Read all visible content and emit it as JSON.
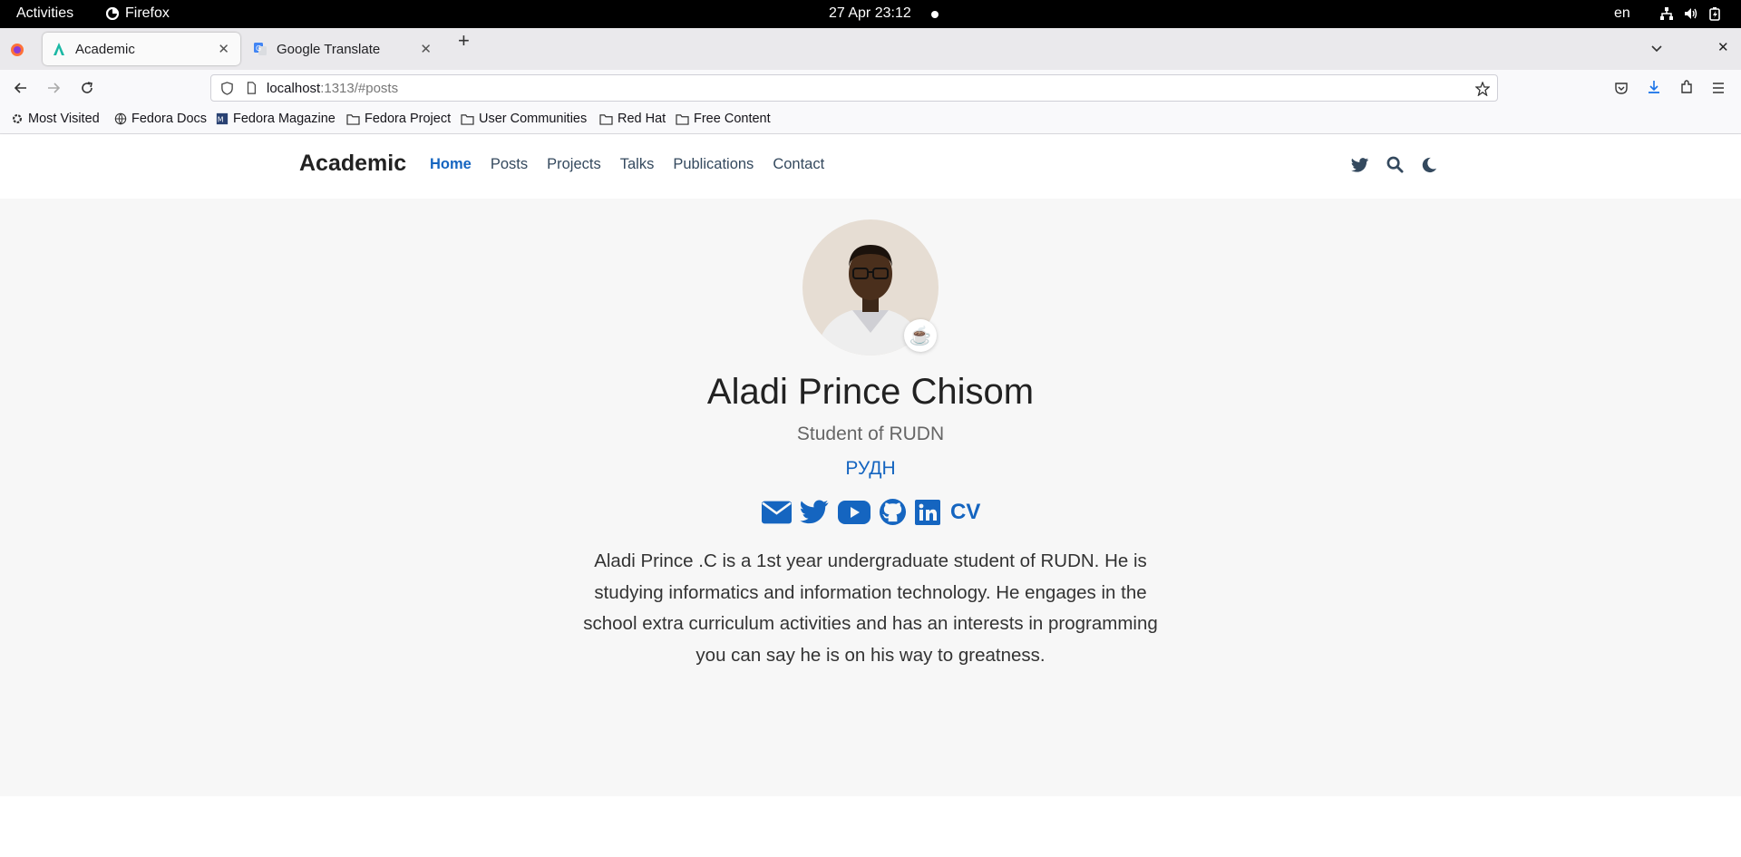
{
  "system": {
    "activities": "Activities",
    "app_name": "Firefox",
    "clock": "27 Apr  23:12",
    "lang": "en"
  },
  "tabs": [
    {
      "title": "Academic",
      "active": true
    },
    {
      "title": "Google Translate",
      "active": false
    }
  ],
  "urlbar": {
    "host": "localhost",
    "rest": ":1313/#posts"
  },
  "bookmarks": [
    "Most Visited",
    "Fedora Docs",
    "Fedora Magazine",
    "Fedora Project",
    "User Communities",
    "Red Hat",
    "Free Content"
  ],
  "site": {
    "brand": "Academic",
    "menu": [
      "Home",
      "Posts",
      "Projects",
      "Talks",
      "Publications",
      "Contact"
    ],
    "active_menu": "Home"
  },
  "profile": {
    "name": "Aladi Prince Chisom",
    "role": "Student of RUDN",
    "organization": "РУДН",
    "status_emoji": "☕",
    "cv_label": "CV",
    "bio": "Aladi Prince .C is a 1st year undergraduate student of RUDN. He is studying informatics and information technology. He engages in the school extra curriculum activities and has an interests in programming you can say he is on his way to greatness."
  },
  "colors": {
    "accent": "#1565c0",
    "page_bg": "#f7f7f7",
    "topbar": "#000000"
  },
  "icons": {
    "social": [
      "envelope-icon",
      "twitter-icon",
      "youtube-icon",
      "github-icon",
      "linkedin-icon"
    ]
  }
}
